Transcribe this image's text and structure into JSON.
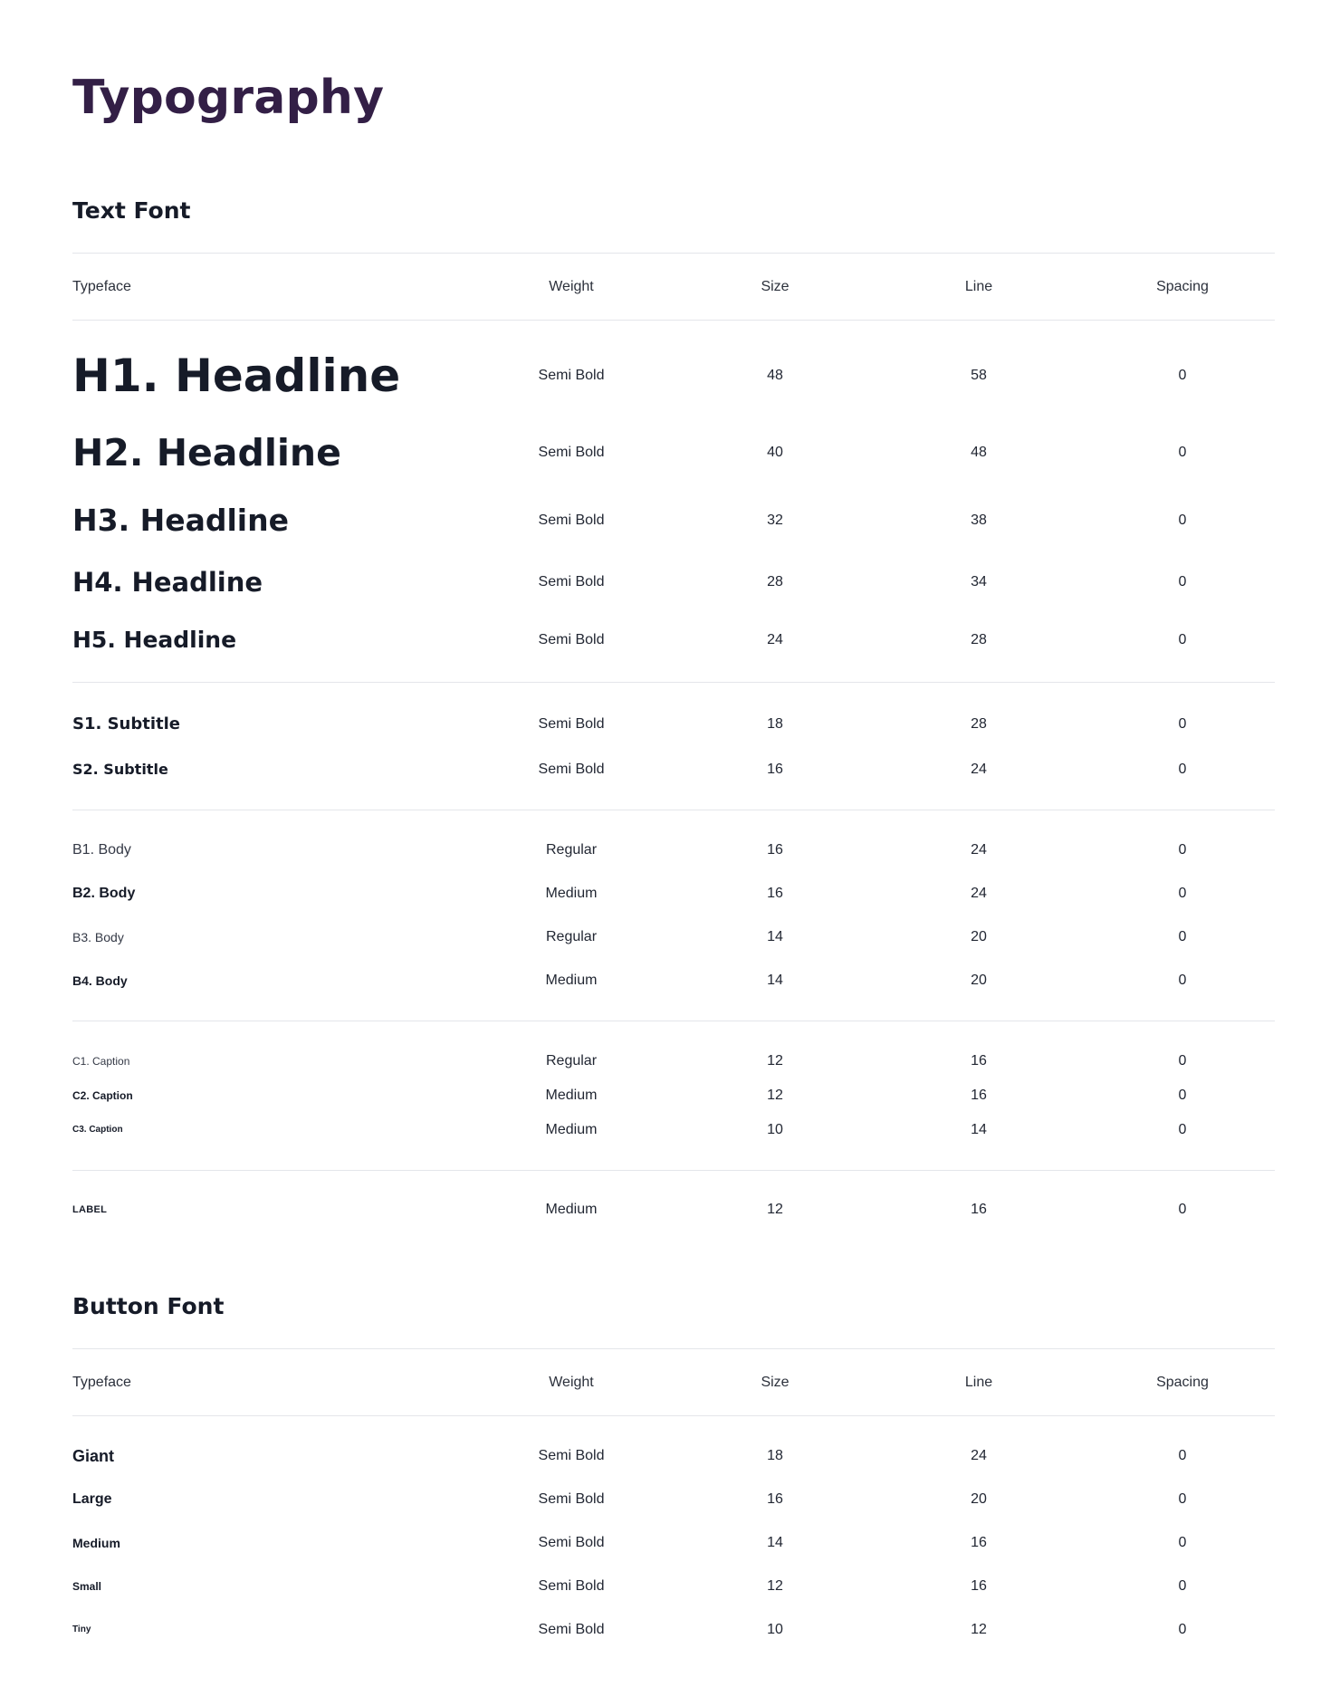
{
  "page": {
    "title": "Typography"
  },
  "text_font": {
    "title": "Text Font",
    "columns": {
      "typeface": "Typeface",
      "weight": "Weight",
      "size": "Size",
      "line": "Line",
      "spacing": "Spacing"
    },
    "rows": [
      {
        "typeface": "H1. Headline",
        "weight": "Semi Bold",
        "size": "48",
        "line": "58",
        "spacing": "0"
      },
      {
        "typeface": "H2. Headline",
        "weight": "Semi Bold",
        "size": "40",
        "line": "48",
        "spacing": "0"
      },
      {
        "typeface": "H3. Headline",
        "weight": "Semi Bold",
        "size": "32",
        "line": "38",
        "spacing": "0"
      },
      {
        "typeface": "H4. Headline",
        "weight": "Semi Bold",
        "size": "28",
        "line": "34",
        "spacing": "0"
      },
      {
        "typeface": "H5. Headline",
        "weight": "Semi Bold",
        "size": "24",
        "line": "28",
        "spacing": "0"
      },
      {
        "typeface": "S1. Subtitle",
        "weight": "Semi Bold",
        "size": "18",
        "line": "28",
        "spacing": "0"
      },
      {
        "typeface": "S2. Subtitle",
        "weight": "Semi Bold",
        "size": "16",
        "line": "24",
        "spacing": "0"
      },
      {
        "typeface": "B1. Body",
        "weight": "Regular",
        "size": "16",
        "line": "24",
        "spacing": "0"
      },
      {
        "typeface": "B2. Body",
        "weight": "Medium",
        "size": "16",
        "line": "24",
        "spacing": "0"
      },
      {
        "typeface": "B3. Body",
        "weight": "Regular",
        "size": "14",
        "line": "20",
        "spacing": "0"
      },
      {
        "typeface": "B4. Body",
        "weight": "Medium",
        "size": "14",
        "line": "20",
        "spacing": "0"
      },
      {
        "typeface": "C1. Caption",
        "weight": "Regular",
        "size": "12",
        "line": "16",
        "spacing": "0"
      },
      {
        "typeface": "C2. Caption",
        "weight": "Medium",
        "size": "12",
        "line": "16",
        "spacing": "0"
      },
      {
        "typeface": "C3. Caption",
        "weight": "Medium",
        "size": "10",
        "line": "14",
        "spacing": "0"
      },
      {
        "typeface": "LABEL",
        "weight": "Medium",
        "size": "12",
        "line": "16",
        "spacing": "0"
      }
    ]
  },
  "button_font": {
    "title": "Button Font",
    "columns": {
      "typeface": "Typeface",
      "weight": "Weight",
      "size": "Size",
      "line": "Line",
      "spacing": "Spacing"
    },
    "rows": [
      {
        "typeface": "Giant",
        "weight": "Semi Bold",
        "size": "18",
        "line": "24",
        "spacing": "0"
      },
      {
        "typeface": "Large",
        "weight": "Semi Bold",
        "size": "16",
        "line": "20",
        "spacing": "0"
      },
      {
        "typeface": "Medium",
        "weight": "Semi Bold",
        "size": "14",
        "line": "16",
        "spacing": "0"
      },
      {
        "typeface": "Small",
        "weight": "Semi Bold",
        "size": "12",
        "line": "16",
        "spacing": "0"
      },
      {
        "typeface": "Tiny",
        "weight": "Semi Bold",
        "size": "10",
        "line": "12",
        "spacing": "0"
      }
    ]
  },
  "colors": {
    "title": "#331f46",
    "text": "#161b28",
    "divider": "#e4e6ea"
  }
}
